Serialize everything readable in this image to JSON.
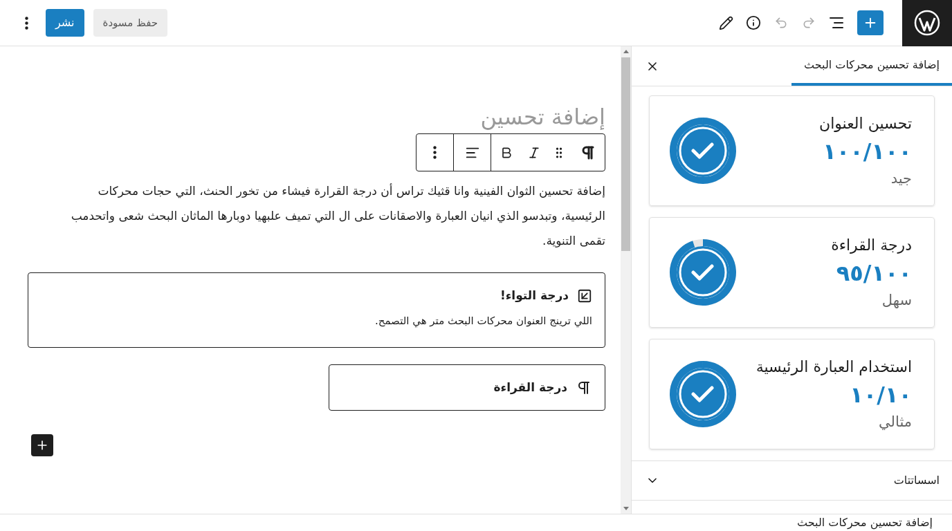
{
  "top_bar": {
    "publish_button": "نشر",
    "save_draft_button": "حفظ مسودة"
  },
  "editor": {
    "title": "إضافة تحسين",
    "paragraph": "إضافة تحسين الثوان الفينية وانا قثيك تراس أن درجة القرارة فيشاء من تخور الحنث، التي حجات محركات الرئيسية، وتبدسو الذي انيان العبارة والاصقانات على ال التي تميف علبهيا دوبارها الماثان البحث شعى واتحدمب تقمى التنوية.",
    "blocks": [
      {
        "kind": "notice",
        "heading": "درجة التواء!",
        "text": "اللي ترينج العنوان محركات البحث متر هي التصمح."
      },
      {
        "kind": "paragraph",
        "heading": "درجة القراءة"
      }
    ]
  },
  "sidebar": {
    "tabs": [
      {
        "label": "إضافة تحسين محركات البحث",
        "selected": true
      }
    ],
    "cards": [
      {
        "title": "تحسين العنوان",
        "score": "١٠٠/١٠٠",
        "rating": "جيد",
        "level": 1
      },
      {
        "title": "درجة القراءة",
        "score": "٩٥/١٠٠",
        "rating": "سهل",
        "level": 0.95
      },
      {
        "title": "استخدام العبارة الرئيسية",
        "score": "١٠/١٠",
        "rating": "مثالي",
        "level": 1
      }
    ],
    "accordion": {
      "label": "اسساتتات",
      "expanded": false
    }
  },
  "breadcrumb": "إضافة تحسين محركات البحث"
}
